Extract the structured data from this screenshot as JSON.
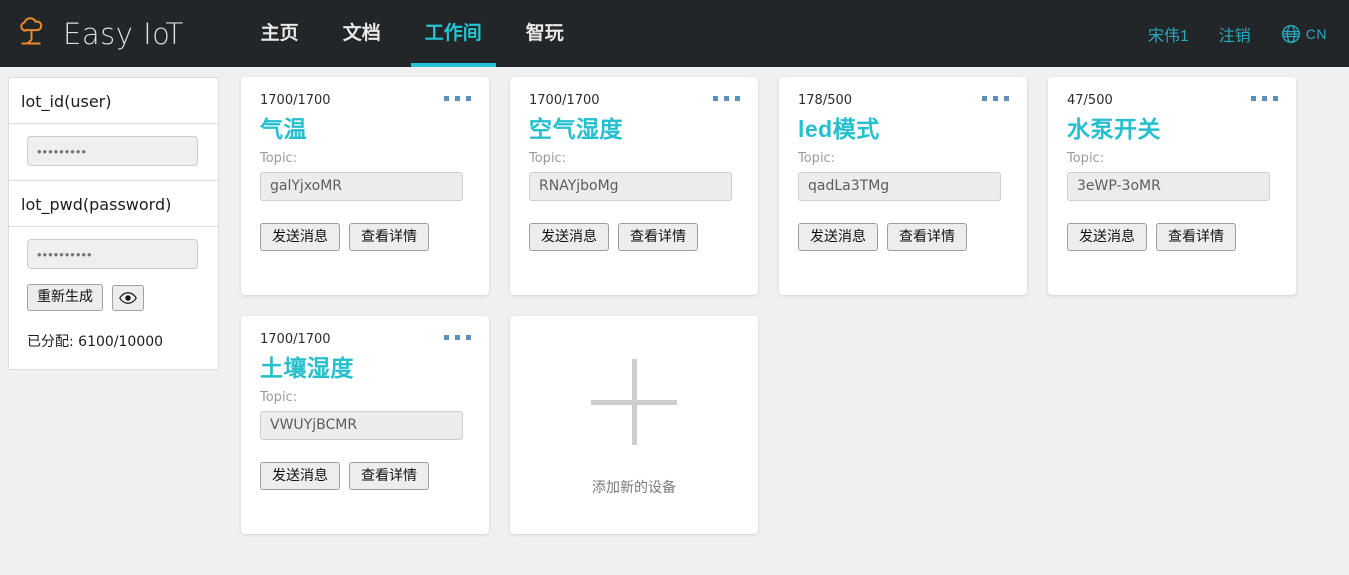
{
  "navbar": {
    "brand": "Easy IoT",
    "logo_icon": "tree-cloud-icon",
    "logo_color": "#ef8a2b",
    "accent_color": "#24c4d4",
    "background_color": "#222629",
    "links": [
      {
        "label": "主页",
        "active": false
      },
      {
        "label": "文档",
        "active": false
      },
      {
        "label": "工作间",
        "active": true
      },
      {
        "label": "智玩",
        "active": false
      }
    ],
    "user": "宋伟1",
    "logout": "注销",
    "language": {
      "icon": "globe-icon",
      "code": "CN"
    }
  },
  "sidebar": {
    "id_section": {
      "title": "lot_id(user)",
      "value": "•••••••••"
    },
    "pwd_section": {
      "title": "lot_pwd(password)",
      "value": "••••••••••",
      "regenerate_label": "重新生成",
      "toggle_icon": "eye-icon"
    },
    "allocation": "已分配:  6100/10000"
  },
  "cards": {
    "topic_label": "Topic:",
    "send_label": "发送消息",
    "detail_label": "查看详情",
    "menu_icon": "three-dots-icon",
    "items": [
      {
        "count": "1700/1700",
        "title": "气温",
        "topic": "galYjxoMR"
      },
      {
        "count": "1700/1700",
        "title": "空气湿度",
        "topic": "RNAYjboMg"
      },
      {
        "count": "178/500",
        "title": "led模式",
        "topic": "qadLa3TMg"
      },
      {
        "count": "47/500",
        "title": "水泵开关",
        "topic": "3eWP-3oMR"
      },
      {
        "count": "1700/1700",
        "title": "土壤湿度",
        "topic": "VWUYjBCMR"
      }
    ],
    "add": {
      "icon": "plus-icon",
      "label": "添加新的设备"
    }
  }
}
